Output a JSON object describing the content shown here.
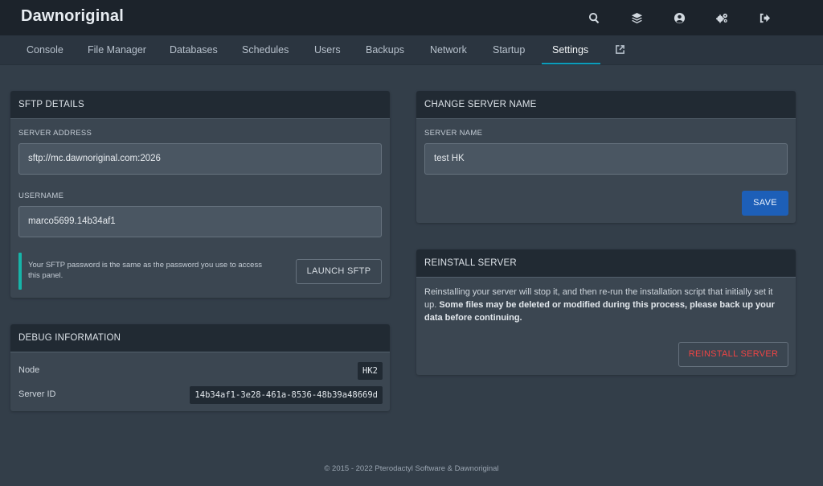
{
  "header": {
    "brand": "Dawnoriginal"
  },
  "top_icons": [
    "search-icon",
    "layers-icon",
    "user-circle-icon",
    "gears-icon",
    "sign-out-icon"
  ],
  "tabs": [
    {
      "label": "Console",
      "active": false
    },
    {
      "label": "File Manager",
      "active": false
    },
    {
      "label": "Databases",
      "active": false
    },
    {
      "label": "Schedules",
      "active": false
    },
    {
      "label": "Users",
      "active": false
    },
    {
      "label": "Backups",
      "active": false
    },
    {
      "label": "Network",
      "active": false
    },
    {
      "label": "Startup",
      "active": false
    },
    {
      "label": "Settings",
      "active": true
    }
  ],
  "sftp": {
    "title": "SFTP DETAILS",
    "address_label": "SERVER ADDRESS",
    "address_value": "sftp://mc.dawnoriginal.com:2026",
    "username_label": "USERNAME",
    "username_value": "marco5699.14b34af1",
    "note": "Your SFTP password is the same as the password you use to access this panel.",
    "launch_label": "LAUNCH SFTP"
  },
  "debug": {
    "title": "DEBUG INFORMATION",
    "node_label": "Node",
    "node_value": "HK2",
    "server_id_label": "Server ID",
    "server_id_value": "14b34af1-3e28-461a-8536-48b39a48669d"
  },
  "rename": {
    "title": "CHANGE SERVER NAME",
    "name_label": "SERVER NAME",
    "name_value": "test HK",
    "save_label": "SAVE"
  },
  "reinstall": {
    "title": "REINSTALL SERVER",
    "desc_plain": "Reinstalling your server will stop it, and then re-run the installation script that initially set it up. ",
    "desc_bold": "Some files may be deleted or modified during this process, please back up your data before continuing.",
    "button_label": "REINSTALL SERVER"
  },
  "footer": {
    "text": "© 2015 - 2022 Pterodactyl Software & Dawnoriginal"
  },
  "colors": {
    "accent": "#0b9dbb",
    "primary_button": "#1d5fb8",
    "danger": "#ef4444",
    "note_bar": "#16b4a8"
  }
}
